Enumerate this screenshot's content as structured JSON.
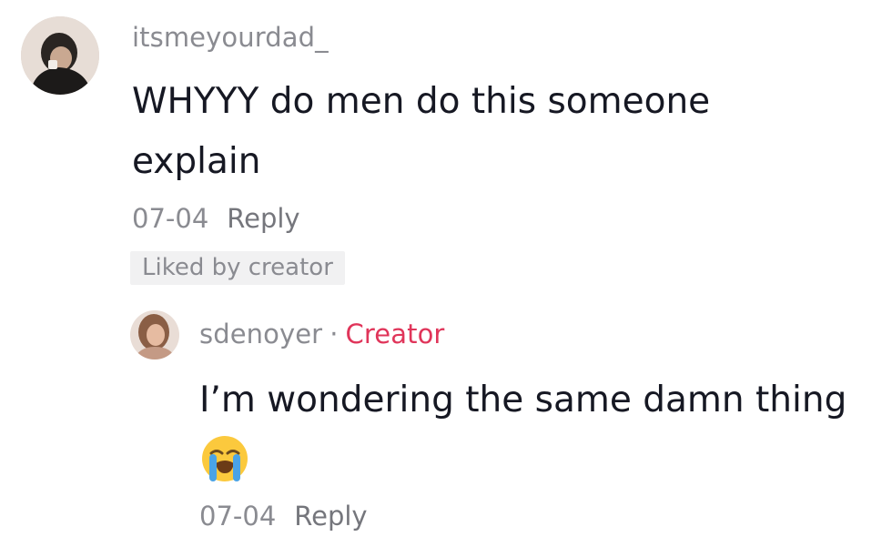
{
  "comment": {
    "username": "itsmeyourdad_",
    "text_line1": "WHYYY do men do this someone",
    "text_line2": "explain",
    "date": "07-04",
    "reply_label": "Reply",
    "liked_badge": "Liked by creator"
  },
  "reply": {
    "username": "sdenoyer",
    "separator": "·",
    "creator_label": "Creator",
    "text": "I’m wondering the same damn thing",
    "emoji": "loudly-crying-face-icon",
    "date": "07-04",
    "reply_label": "Reply"
  },
  "colors": {
    "username_gray": "#8a8b91",
    "text_dark": "#161823",
    "creator_red": "#e0355a",
    "badge_bg": "#f1f1f2"
  }
}
